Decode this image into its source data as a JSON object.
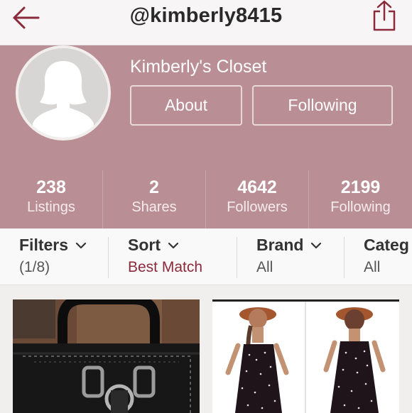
{
  "header": {
    "title": "@kimberly8415",
    "accent_color": "#8a2a3b"
  },
  "profile": {
    "closet_name": "Kimberly's Closet",
    "about_label": "About",
    "following_label": "Following",
    "background_color": "#b98e94"
  },
  "stats": [
    {
      "count": "238",
      "label": "Listings"
    },
    {
      "count": "2",
      "label": "Shares"
    },
    {
      "count": "4642",
      "label": "Followers"
    },
    {
      "count": "2199",
      "label": "Following"
    }
  ],
  "filters": [
    {
      "name": "Filters",
      "value": "(1/8)"
    },
    {
      "name": "Sort",
      "value": "Best Match"
    },
    {
      "name": "Brand",
      "value": "All"
    },
    {
      "name": "Categ",
      "value": "All"
    }
  ],
  "icons": {
    "back": "back-arrow-icon",
    "share": "share-icon",
    "avatar": "default-avatar-icon",
    "dropdown": "chevron-down-icon"
  }
}
